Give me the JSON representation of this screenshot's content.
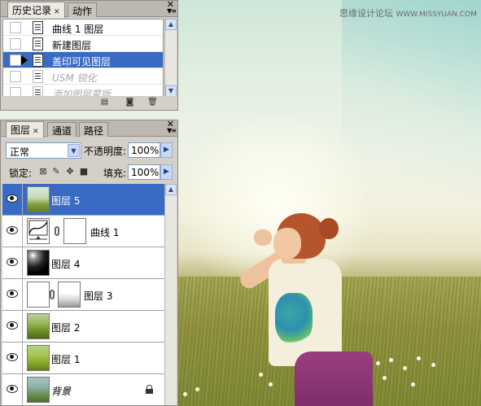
{
  "watermark": {
    "text": "思缘设计论坛",
    "url_text": "WWW.MISSYUAN.COM"
  },
  "history_panel": {
    "tabs": [
      {
        "label": "历史记录",
        "active": true
      },
      {
        "label": "动作",
        "active": false
      }
    ],
    "close_glyph": "✕",
    "items": [
      {
        "label": "曲线 1 图层",
        "selected": false,
        "dimmed": false
      },
      {
        "label": "新建图层",
        "selected": false,
        "dimmed": false
      },
      {
        "label": "盖印可见图层",
        "selected": true,
        "dimmed": false
      },
      {
        "label": "USM 锐化",
        "selected": false,
        "dimmed": true
      },
      {
        "label": "添加图层蒙版",
        "selected": false,
        "dimmed": true
      }
    ],
    "bottom_icons": [
      "new-document-from-state-icon",
      "snapshot-camera-icon",
      "trash-icon"
    ]
  },
  "layers_panel": {
    "tabs": [
      {
        "label": "图层",
        "active": true
      },
      {
        "label": "通道",
        "active": false
      },
      {
        "label": "路径",
        "active": false
      }
    ],
    "close_glyph": "✕",
    "blend_mode": "正常",
    "opacity_label": "不透明度:",
    "opacity_value": "100%",
    "lock_label": "锁定:",
    "fill_label": "填充:",
    "fill_value": "100%",
    "layers": [
      {
        "name": "图层 5",
        "selected": true,
        "thumb": "photo",
        "mask": null,
        "italic": false,
        "locked": false
      },
      {
        "name": "曲线 1",
        "selected": false,
        "thumb": "curve",
        "mask": "white",
        "italic": false,
        "locked": false
      },
      {
        "name": "图层 4",
        "selected": false,
        "thumb": "black",
        "mask": null,
        "italic": false,
        "locked": false
      },
      {
        "name": "图层 3",
        "selected": false,
        "thumb": "white",
        "mask": "mask3",
        "italic": false,
        "locked": false
      },
      {
        "name": "图层 2",
        "selected": false,
        "thumb": "photo2",
        "mask": null,
        "italic": false,
        "locked": false
      },
      {
        "name": "图层 1",
        "selected": false,
        "thumb": "photo3",
        "mask": null,
        "italic": false,
        "locked": false
      },
      {
        "name": "背景",
        "selected": false,
        "thumb": "photo4",
        "mask": null,
        "italic": true,
        "locked": true
      }
    ]
  },
  "colors": {
    "selection": "#3a6bc4",
    "panel_bg": "#d4d0c8"
  }
}
